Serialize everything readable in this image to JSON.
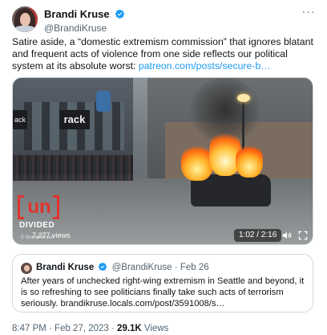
{
  "author": {
    "display_name": "Brandi Kruse",
    "handle": "@BrandiKruse"
  },
  "more_icon": "more-horizontal-icon",
  "tweet": {
    "text": "Satire aside, a “domestic extremism commission” that ignores blatant and frequent acts of violence from one side reflects our political system at its absolute worst: ",
    "link": "patreon.com/posts/secure-b…"
  },
  "media": {
    "store_sign": "rack",
    "store_sign_small": "ack",
    "logo_text": "un",
    "logo_sub": "DIVIDED",
    "views_overlay": "7,277 views",
    "time": "1:02 / 2:16",
    "watermark": "© Brandi Kruse"
  },
  "quote": {
    "display_name": "Brandi Kruse",
    "handle": "@BrandiKruse",
    "date": "· Feb 26",
    "text": "After years of unchecked right-wing extremism in Seattle and beyond, it is so refreshing to see politicians finally take such acts of terrorism seriously. brandikruse.locals.com/post/3591008/s…"
  },
  "footer": {
    "timestamp": "8:47 PM · Feb 27, 2023 · ",
    "views_count": "29.1K",
    "views_label": " Views"
  },
  "colors": {
    "link": "#1d9bf0",
    "verified": "#1d9bf0",
    "muted": "#536471",
    "logo_red": "#e0342f"
  }
}
